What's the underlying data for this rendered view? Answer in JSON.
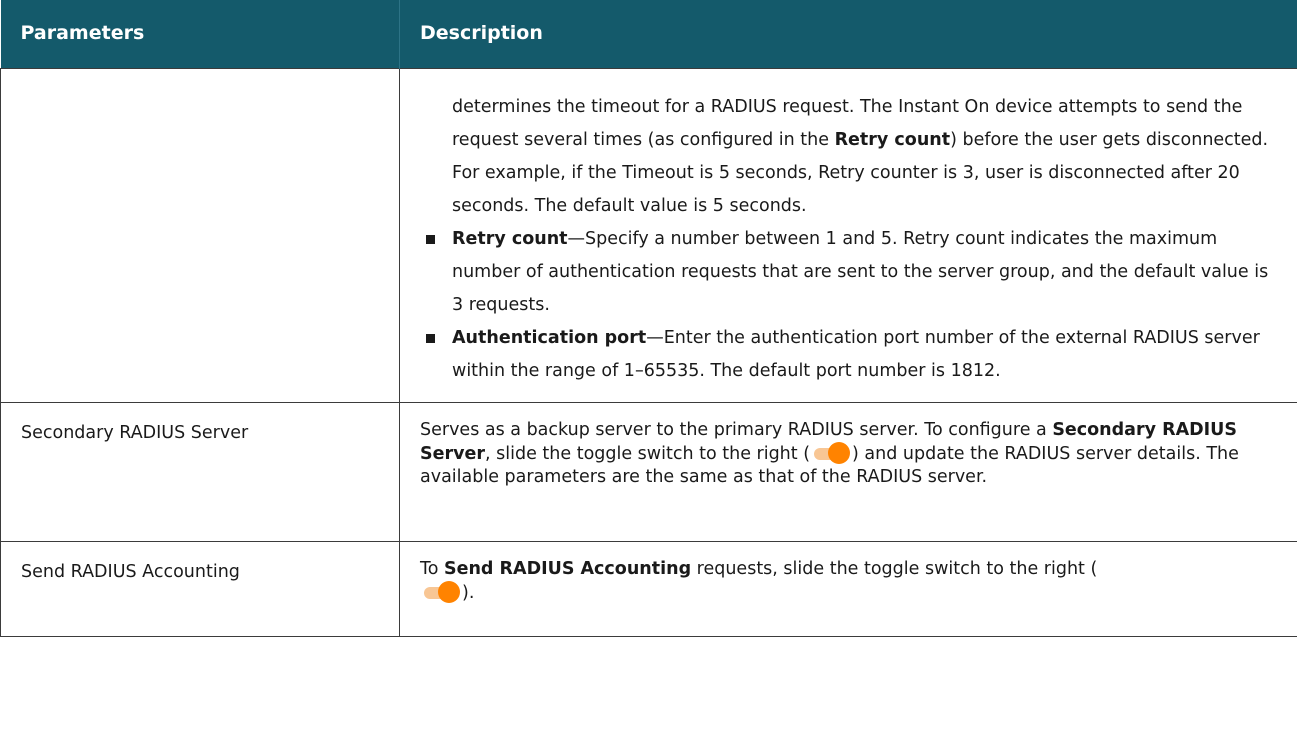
{
  "table": {
    "headers": {
      "parameters": "Parameters",
      "description": "Description"
    },
    "row1": {
      "param": "",
      "continued_text": {
        "p1": "determines the timeout for a RADIUS request. The Instant On device attempts to send the request several times (as configured in the ",
        "p1_bold": "Retry count",
        "p1_tail": ") before the user gets disconnected. For example, if the Timeout is 5 seconds, Retry counter is 3, user is disconnected after 20 seconds. The default value is 5 seconds."
      },
      "bullets": [
        {
          "bold": "Retry count",
          "text": "—Specify a number between 1 and 5. Retry count indicates the maximum number of authentication requests that are sent to the server group, and the default value is 3 requests."
        },
        {
          "bold": "Authentication port",
          "text": "—Enter the authentication port number of the external RADIUS server within the range of 1–65535. The default port number is 1812."
        }
      ]
    },
    "row2": {
      "param": "Secondary RADIUS Server",
      "desc_a": "Serves as a backup server to the primary RADIUS server. To configure a ",
      "desc_bold": "Secondary RADIUS Server",
      "desc_b": ", slide the toggle switch to the right (",
      "desc_c": ") and update the RADIUS server details. The available parameters are the same as that of the RADIUS server."
    },
    "row3": {
      "param": "Send RADIUS Accounting",
      "desc_a": "To ",
      "desc_bold": "Send RADIUS Accounting",
      "desc_b": " requests, slide the toggle switch to the right (",
      "desc_c": ")."
    }
  },
  "toggle": {
    "icon": "toggle-on-icon",
    "track_color": "#f8c694",
    "knob_color": "#ff8300"
  },
  "colors": {
    "header_bg": "#145a6b",
    "header_text": "#ffffff",
    "border": "#3b3b3b"
  }
}
